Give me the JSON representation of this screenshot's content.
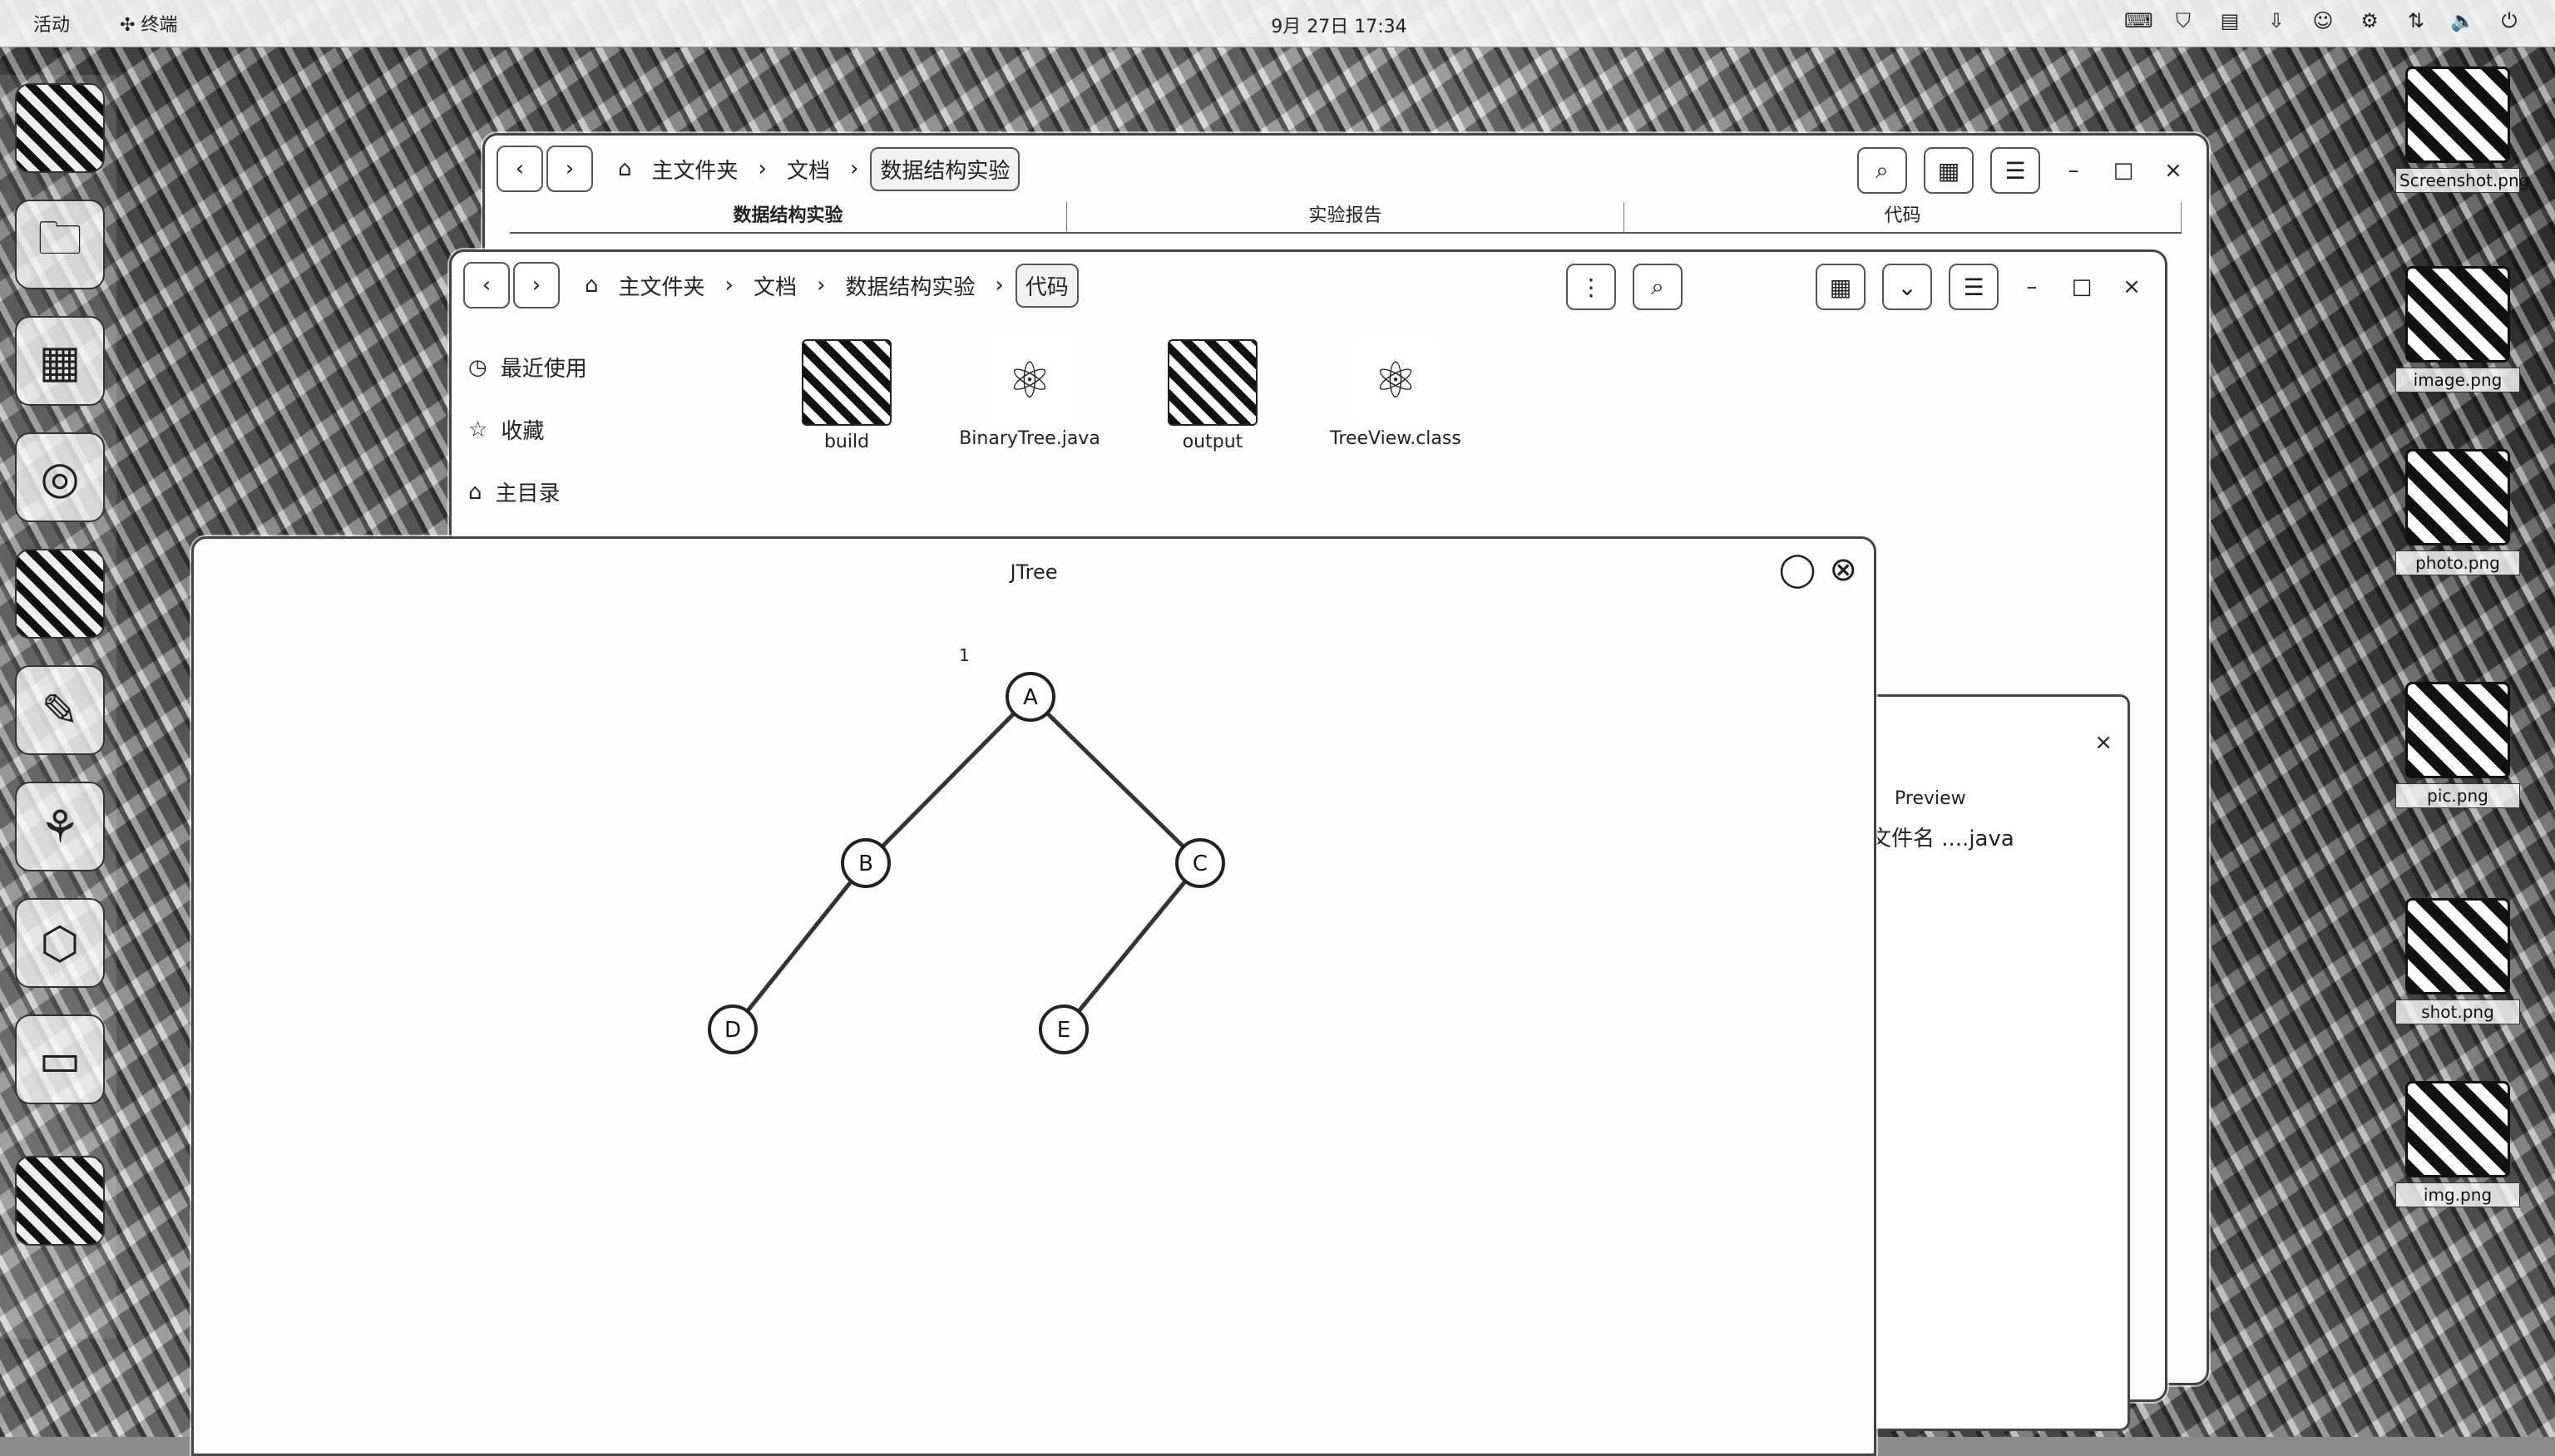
{
  "topbar": {
    "activities": "活动",
    "app_name": "终端",
    "clock": "9月 27日 17:34",
    "tray_icons": [
      "input-icon",
      "shield-icon",
      "clipboard-icon",
      "download-icon",
      "user-icon",
      "settings-icon",
      "network-icon",
      "volume-icon",
      "power-icon"
    ]
  },
  "dock": {
    "items": [
      "image-app",
      "files-app",
      "calculator-app",
      "browser-app",
      "photo-app",
      "paint-app",
      "network-app",
      "cube-app",
      "editor-app",
      "app-grid"
    ]
  },
  "desktop_icons": [
    {
      "label": "Screenshot.png"
    },
    {
      "label": "image.png"
    },
    {
      "label": "photo.png"
    },
    {
      "label": "pic.png"
    },
    {
      "label": "shot.png"
    },
    {
      "label": "img.png"
    }
  ],
  "back_window": {
    "crumbs": [
      "主文件夹",
      "文档",
      "数据结构实验"
    ],
    "search_icon": "search-icon"
  },
  "files_window": {
    "tabs": [
      "数据结构实验",
      "实验报告",
      "代码"
    ],
    "crumbs": [
      "主文件夹",
      "文档",
      "数据结构实验",
      "代码"
    ],
    "sidebar": [
      {
        "icon": "clock-icon",
        "label": "最近使用"
      },
      {
        "icon": "star-icon",
        "label": "收藏"
      },
      {
        "icon": "home-icon",
        "label": "主目录"
      }
    ],
    "files": [
      {
        "label": "build",
        "kind": "folder"
      },
      {
        "label": "BinaryTree.java",
        "kind": "code"
      },
      {
        "label": "output",
        "kind": "folder"
      },
      {
        "label": "TreeView.class",
        "kind": "code"
      }
    ]
  },
  "graph_window": {
    "title": "JTree",
    "root_label": "1",
    "nodes": [
      {
        "id": "A",
        "label": "A"
      },
      {
        "id": "B",
        "label": "B"
      },
      {
        "id": "C",
        "label": "C"
      },
      {
        "id": "D",
        "label": "D"
      },
      {
        "id": "E",
        "label": "E"
      }
    ]
  },
  "side_window": {
    "title": "Preview",
    "text": "文件名 ....java"
  }
}
